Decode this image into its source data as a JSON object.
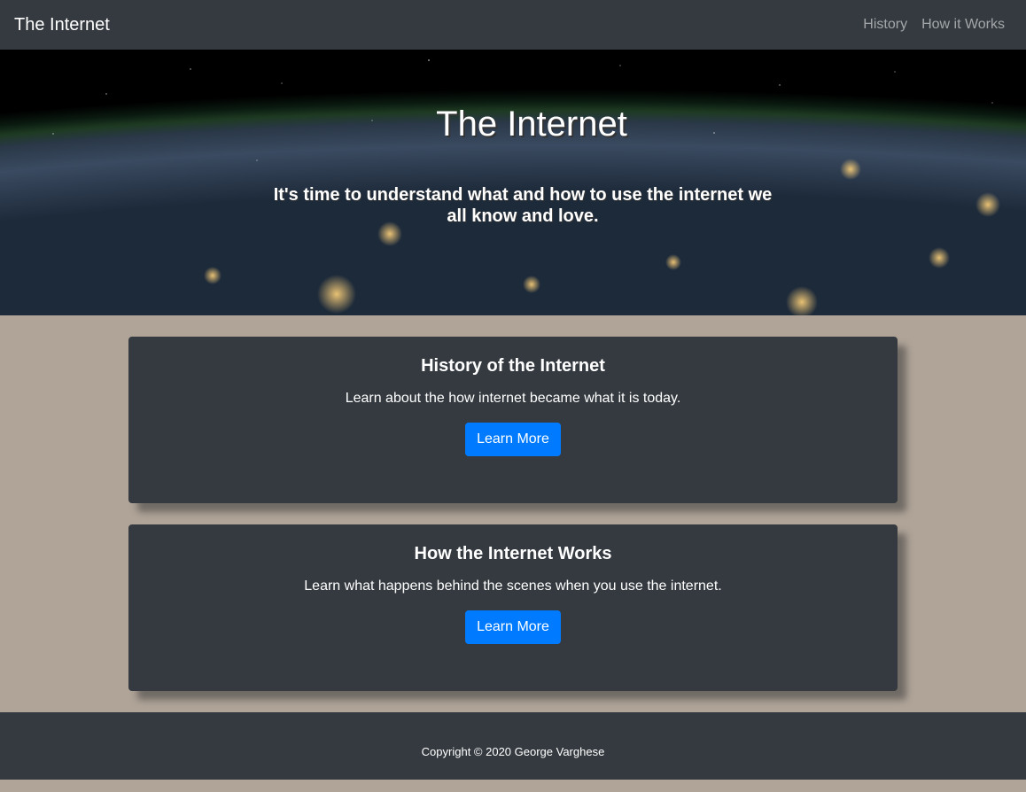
{
  "navbar": {
    "brand": "The Internet",
    "links": [
      "History",
      "How it Works"
    ]
  },
  "hero": {
    "title": "The Internet",
    "subtitle": "It's time to understand what and how to use the internet we all know and love."
  },
  "cards": [
    {
      "title": "History of the Internet",
      "text": "Learn about the how internet became what it is today.",
      "button": "Learn More"
    },
    {
      "title": "How the Internet Works",
      "text": "Learn what happens behind the scenes when you use the internet.",
      "button": "Learn More"
    }
  ],
  "footer": {
    "copyright": "Copyright © 2020 George Varghese"
  },
  "colors": {
    "navbar_bg": "#343a40",
    "page_bg": "#b0a498",
    "button_bg": "#007bff"
  }
}
